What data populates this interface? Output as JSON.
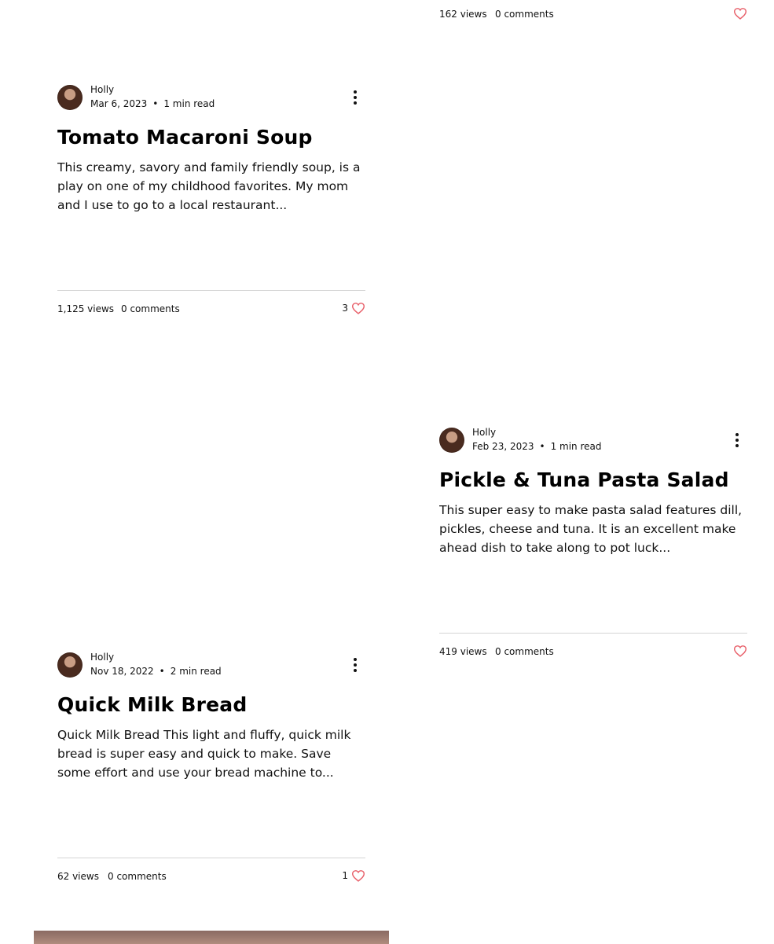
{
  "colors": {
    "heart_outline": "#e8606a",
    "divider": "#d4d4d4",
    "text": "#111111"
  },
  "top_card": {
    "views": "162 views",
    "comments": "0 comments",
    "like_icon": "heart-outline-icon"
  },
  "posts": [
    {
      "author": "Holly",
      "date": "Mar 6, 2023",
      "separator": "•",
      "read_time": "1 min read",
      "title": "Tomato Macaroni Soup",
      "excerpt": "This creamy, savory and family friendly soup, is a play on one of my childhood favorites. My mom and I use to go to a local restaurant...",
      "views": "1,125 views",
      "comments": "0 comments",
      "likes": "3"
    },
    {
      "author": "Holly",
      "date": "Feb 23, 2023",
      "separator": "•",
      "read_time": "1 min read",
      "title": "Pickle & Tuna Pasta Salad",
      "excerpt": "This super easy to make pasta salad features dill, pickles, cheese and tuna. It is an excellent make ahead dish to take along to pot luck...",
      "views": "419 views",
      "comments": "0 comments",
      "likes": ""
    },
    {
      "author": "Holly",
      "date": "Nov 18, 2022",
      "separator": "•",
      "read_time": "2 min read",
      "title": "Quick Milk Bread",
      "excerpt": "Quick Milk Bread This light and fluffy, quick milk bread is super easy and quick to make. Save some effort and use your bread machine to...",
      "views": "62 views",
      "comments": "0 comments",
      "likes": "1"
    }
  ]
}
